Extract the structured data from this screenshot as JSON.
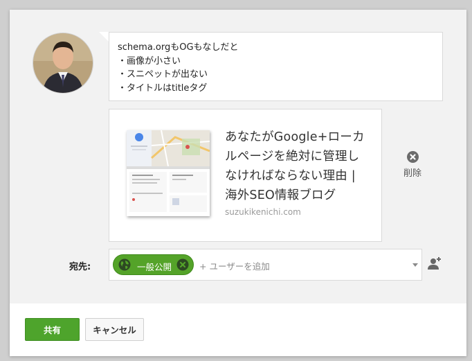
{
  "post": {
    "lines": [
      "schema.orgもOGもなしだと",
      "・画像が小さい",
      "・スニペットが出ない",
      "・タイトルはtitleタグ"
    ]
  },
  "link_preview": {
    "title": "あなたがGoogle+ローカルページを絶対に管理しなければならない理由 | 海外SEO情報ブログ",
    "domain": "suzukikenichi.com",
    "remove_label": "削除"
  },
  "audience": {
    "label": "宛先:",
    "chip_label": "一般公開",
    "add_placeholder": "+ ユーザーを追加"
  },
  "footer": {
    "share_label": "共有",
    "cancel_label": "キャンセル"
  },
  "colors": {
    "accent_green": "#4ea42c",
    "chip_green": "#54a329"
  },
  "icons": {
    "avatar": "profile-photo",
    "remove": "close-circle-icon",
    "chip": "globe-icon",
    "chip_remove": "close-circle-icon",
    "add_person": "person-add-icon"
  }
}
